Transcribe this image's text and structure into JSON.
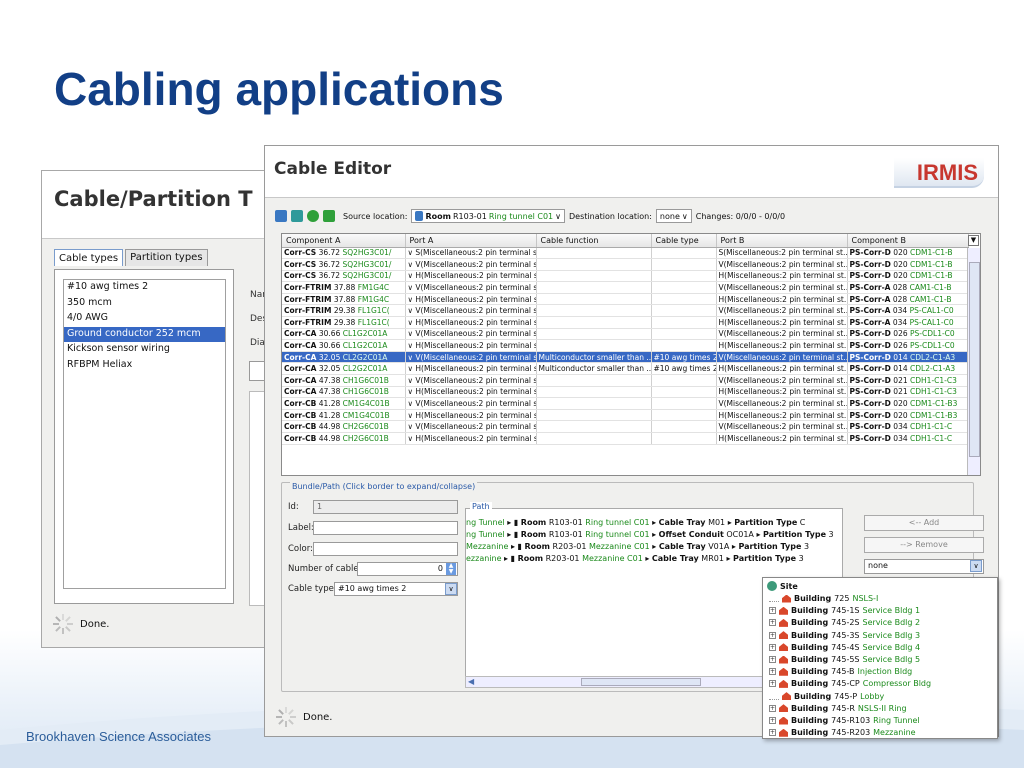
{
  "slide": {
    "title": "Cabling applications",
    "footer": "Brookhaven Science Associates"
  },
  "back_window": {
    "title": "Cable/Partition T",
    "tabs": [
      "Cable types",
      "Partition types"
    ],
    "items": [
      "#10 awg times 2",
      "350 mcm",
      "4/0 AWG",
      "Ground conductor 252 mcm",
      "Kickson sensor wiring",
      "RFBPM Heliax"
    ],
    "selected_index": 3,
    "side_labels": [
      "Nar",
      "Des",
      "Dia"
    ],
    "status": "Done."
  },
  "editor": {
    "title": "Cable Editor",
    "logo": "IRMIS",
    "toolbar": {
      "source_label": "Source location:",
      "source_type": "Room",
      "source_id": "R103-01",
      "source_name": "Ring tunnel C01",
      "dest_label": "Destination location:",
      "dest_value": "none",
      "changes": "Changes: 0/0/0 - 0/0/0"
    },
    "columns": [
      "Component A",
      "Port A",
      "Cable function",
      "Cable type",
      "Port B",
      "Component B"
    ],
    "rows": [
      {
        "a": "Corr-CS",
        "an": "36.72",
        "ac": "SQ2HG3C01/",
        "pa": "S(Miscellaneous:2 pin terminal st...",
        "fn": "",
        "ct": "",
        "pb": "S(Miscellaneous:2 pin terminal st...",
        "b": "PS-Corr-D",
        "bn": "020",
        "bc": "CDM1-C1-B"
      },
      {
        "a": "Corr-CS",
        "an": "36.72",
        "ac": "SQ2HG3C01/",
        "pa": "V(Miscellaneous:2 pin terminal st...",
        "fn": "",
        "ct": "",
        "pb": "V(Miscellaneous:2 pin terminal st...",
        "b": "PS-Corr-D",
        "bn": "020",
        "bc": "CDM1-C1-B"
      },
      {
        "a": "Corr-CS",
        "an": "36.72",
        "ac": "SQ2HG3C01/",
        "pa": "H(Miscellaneous:2 pin terminal st...",
        "fn": "",
        "ct": "",
        "pb": "H(Miscellaneous:2 pin terminal st...",
        "b": "PS-Corr-D",
        "bn": "020",
        "bc": "CDM1-C1-B"
      },
      {
        "a": "Corr-FTRIM",
        "an": "37.88",
        "ac": "FM1G4C",
        "pa": "V(Miscellaneous:2 pin terminal st...",
        "fn": "",
        "ct": "",
        "pb": "V(Miscellaneous:2 pin terminal st...",
        "b": "PS-Corr-A",
        "bn": "028",
        "bc": "CAM1-C1-B"
      },
      {
        "a": "Corr-FTRIM",
        "an": "37.88",
        "ac": "FM1G4C",
        "pa": "H(Miscellaneous:2 pin terminal st...",
        "fn": "",
        "ct": "",
        "pb": "H(Miscellaneous:2 pin terminal st...",
        "b": "PS-Corr-A",
        "bn": "028",
        "bc": "CAM1-C1-B"
      },
      {
        "a": "Corr-FTRIM",
        "an": "29.38",
        "ac": "FL1G1C(",
        "pa": "V(Miscellaneous:2 pin terminal st...",
        "fn": "",
        "ct": "",
        "pb": "V(Miscellaneous:2 pin terminal st...",
        "b": "PS-Corr-A",
        "bn": "034",
        "bc": "PS-CAL1-C0"
      },
      {
        "a": "Corr-FTRIM",
        "an": "29.38",
        "ac": "FL1G1C(",
        "pa": "H(Miscellaneous:2 pin terminal st...",
        "fn": "",
        "ct": "",
        "pb": "H(Miscellaneous:2 pin terminal st...",
        "b": "PS-Corr-A",
        "bn": "034",
        "bc": "PS-CAL1-C0"
      },
      {
        "a": "Corr-CA",
        "an": "30.66",
        "ac": "CL1G2C01A",
        "pa": "V(Miscellaneous:2 pin terminal st...",
        "fn": "",
        "ct": "",
        "pb": "V(Miscellaneous:2 pin terminal st...",
        "b": "PS-Corr-D",
        "bn": "026",
        "bc": "PS-CDL1-C0"
      },
      {
        "a": "Corr-CA",
        "an": "30.66",
        "ac": "CL1G2C01A",
        "pa": "H(Miscellaneous:2 pin terminal st...",
        "fn": "",
        "ct": "",
        "pb": "H(Miscellaneous:2 pin terminal st...",
        "b": "PS-Corr-D",
        "bn": "026",
        "bc": "PS-CDL1-C0"
      },
      {
        "a": "Corr-CA",
        "an": "32.05",
        "ac": "CL2G2C01A",
        "pa": "V(Miscellaneous:2 pin terminal st...",
        "fn": "Multiconductor smaller than ...",
        "ct": "#10 awg times 2",
        "pb": "V(Miscellaneous:2 pin terminal st...",
        "b": "PS-Corr-D",
        "bn": "014",
        "bc": "CDL2-C1-A3",
        "sel": true
      },
      {
        "a": "Corr-CA",
        "an": "32.05",
        "ac": "CL2G2C01A",
        "pa": "H(Miscellaneous:2 pin terminal st...",
        "fn": "Multiconductor smaller than ...",
        "ct": "#10 awg times 2",
        "pb": "H(Miscellaneous:2 pin terminal st...",
        "b": "PS-Corr-D",
        "bn": "014",
        "bc": "CDL2-C1-A3"
      },
      {
        "a": "Corr-CA",
        "an": "47.38",
        "ac": "CH1G6C01B",
        "pa": "V(Miscellaneous:2 pin terminal st...",
        "fn": "",
        "ct": "",
        "pb": "V(Miscellaneous:2 pin terminal st...",
        "b": "PS-Corr-D",
        "bn": "021",
        "bc": "CDH1-C1-C3"
      },
      {
        "a": "Corr-CA",
        "an": "47.38",
        "ac": "CH1G6C01B",
        "pa": "H(Miscellaneous:2 pin terminal st...",
        "fn": "",
        "ct": "",
        "pb": "H(Miscellaneous:2 pin terminal st...",
        "b": "PS-Corr-D",
        "bn": "021",
        "bc": "CDH1-C1-C3"
      },
      {
        "a": "Corr-CB",
        "an": "41.28",
        "ac": "CM1G4C01B",
        "pa": "V(Miscellaneous:2 pin terminal st...",
        "fn": "",
        "ct": "",
        "pb": "V(Miscellaneous:2 pin terminal st...",
        "b": "PS-Corr-D",
        "bn": "020",
        "bc": "CDM1-C1-B3"
      },
      {
        "a": "Corr-CB",
        "an": "41.28",
        "ac": "CM1G4C01B",
        "pa": "H(Miscellaneous:2 pin terminal st...",
        "fn": "",
        "ct": "",
        "pb": "H(Miscellaneous:2 pin terminal st...",
        "b": "PS-Corr-D",
        "bn": "020",
        "bc": "CDM1-C1-B3"
      },
      {
        "a": "Corr-CB",
        "an": "44.98",
        "ac": "CH2G6C01B",
        "pa": "V(Miscellaneous:2 pin terminal st...",
        "fn": "",
        "ct": "",
        "pb": "V(Miscellaneous:2 pin terminal st...",
        "b": "PS-Corr-D",
        "bn": "034",
        "bc": "CDH1-C1-C"
      },
      {
        "a": "Corr-CB",
        "an": "44.98",
        "ac": "CH2G6C01B",
        "pa": "H(Miscellaneous:2 pin terminal st...",
        "fn": "",
        "ct": "",
        "pb": "H(Miscellaneous:2 pin terminal st...",
        "b": "PS-Corr-D",
        "bn": "034",
        "bc": "CDH1-C1-C"
      }
    ],
    "bundle": {
      "legend": "Bundle/Path (Click border to expand/collapse)",
      "id_label": "Id:",
      "id_value": "1",
      "label_label": "Label:",
      "label_value": "",
      "color_label": "Color:",
      "color_value": "",
      "num_label": "Number of cables:",
      "num_value": "0",
      "type_label": "Cable type:",
      "type_value": "#10 awg times 2"
    },
    "path": {
      "legend": "Path",
      "rows": [
        {
          "pre": "ng Tunnel",
          "room": "R103-01",
          "roomname": "Ring tunnel C01",
          "kind": "Cable Tray",
          "kid": "M01",
          "ptype": "Partition Type",
          "pval": "C"
        },
        {
          "pre": "ng Tunnel",
          "room": "R103-01",
          "roomname": "Ring tunnel C01",
          "kind": "Offset Conduit",
          "kid": "OC01A",
          "ptype": "Partition Type",
          "pval": "3"
        },
        {
          "pre": "Mezzanine",
          "room": "R203-01",
          "roomname": "Mezzanine C01",
          "kind": "Cable Tray",
          "kid": "V01A",
          "ptype": "Partition Type",
          "pval": "3"
        },
        {
          "pre": "ezzanine",
          "room": "R203-01",
          "roomname": "Mezzanine C01",
          "kind": "Cable Tray",
          "kid": "MR01",
          "ptype": "Partition Type",
          "pval": "3"
        }
      ],
      "room_word": "Room",
      "add": "<-- Add",
      "remove": "--> Remove",
      "select_value": "none"
    },
    "status": "Done."
  },
  "tree": {
    "root": "Site",
    "word": "Building",
    "items": [
      {
        "id": "725",
        "name": "NSLS-I",
        "exp": false
      },
      {
        "id": "745-1S",
        "name": "Service Bldg 1",
        "exp": true
      },
      {
        "id": "745-2S",
        "name": "Service Bdlg 2",
        "exp": true
      },
      {
        "id": "745-3S",
        "name": "Service Bdlg 3",
        "exp": true
      },
      {
        "id": "745-4S",
        "name": "Service Bdlg 4",
        "exp": true
      },
      {
        "id": "745-5S",
        "name": "Service Bdlg 5",
        "exp": true
      },
      {
        "id": "745-B",
        "name": "Injection Bldg",
        "exp": true
      },
      {
        "id": "745-CP",
        "name": "Compressor Bldg",
        "exp": true
      },
      {
        "id": "745-P",
        "name": "Lobby",
        "exp": false
      },
      {
        "id": "745-R",
        "name": "NSLS-II Ring",
        "exp": true
      },
      {
        "id": "745-R103",
        "name": "Ring Tunnel",
        "exp": true
      },
      {
        "id": "745-R203",
        "name": "Mezzanine",
        "exp": true
      }
    ]
  }
}
